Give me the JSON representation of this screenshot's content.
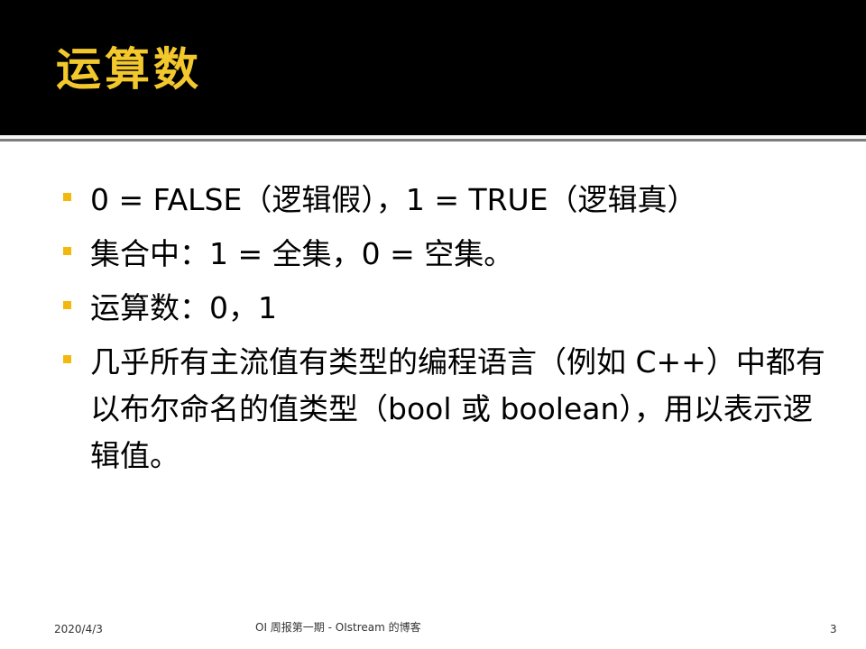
{
  "title": "运算数",
  "bullets": [
    "0 = FALSE（逻辑假），1 = TRUE（逻辑真）",
    "集合中：1 = 全集，0 = 空集。",
    "运算数：0，1",
    "几乎所有主流值有类型的编程语言（例如 C++）中都有以布尔命名的值类型（bool 或 boolean），用以表示逻辑值。"
  ],
  "footer": {
    "date": "2020/4/3",
    "center": "OI 周报第一期 - OIstream 的博客",
    "page_number": "3"
  },
  "colors": {
    "title_bar": "#000000",
    "title_text": "#f3c82d",
    "bullet_marker": "#f2b80d",
    "background": "#ffffff"
  }
}
